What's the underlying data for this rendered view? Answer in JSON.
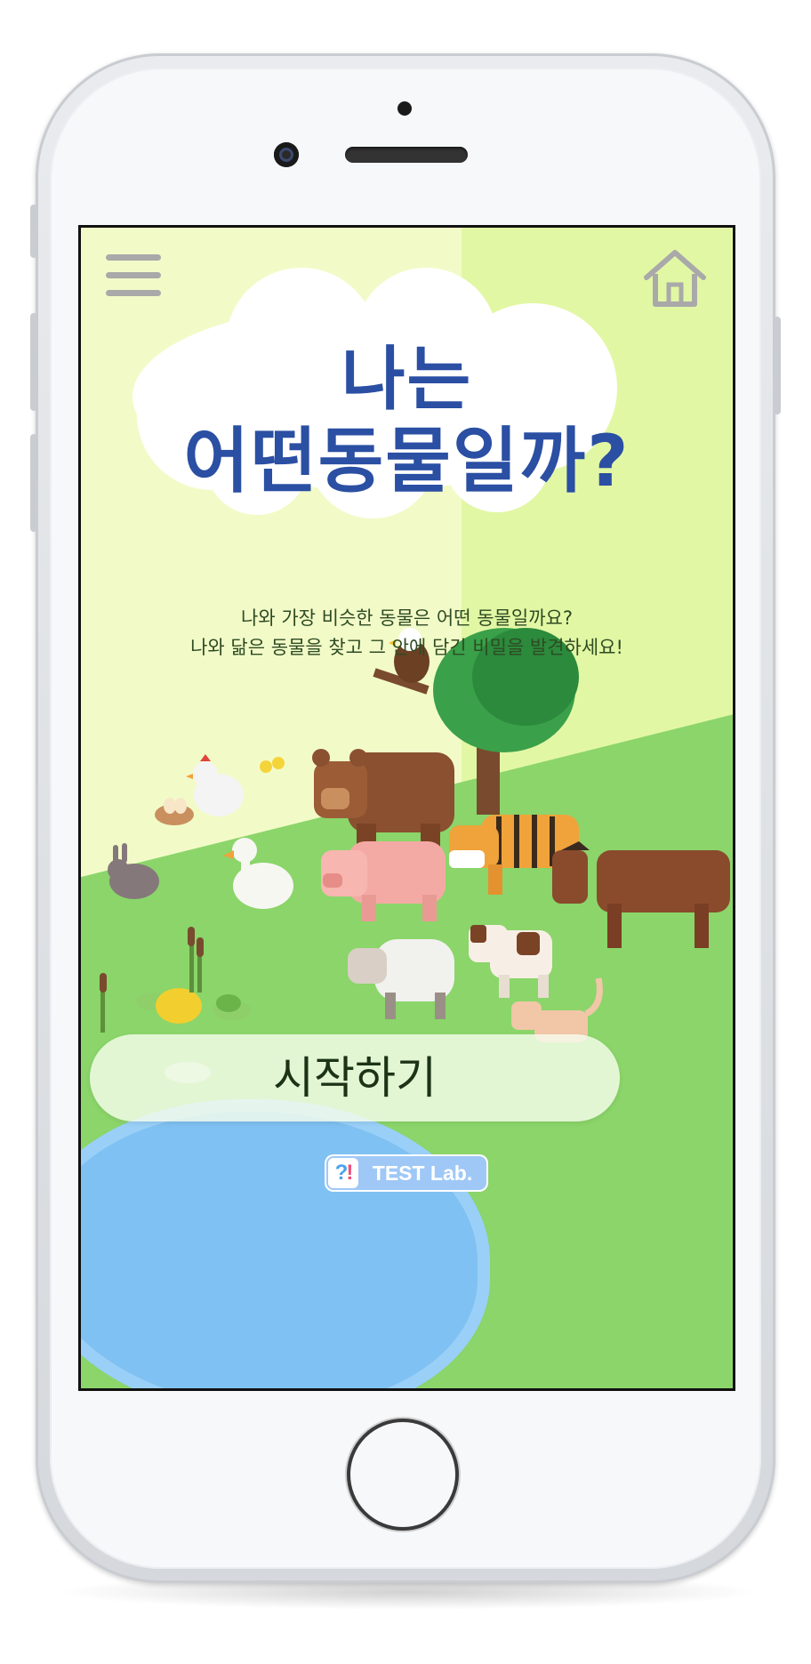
{
  "app": {
    "title_line1": "나는",
    "title_line2": "어떤동물일까?",
    "subtitle_line1": "나와 가장 비슷한 동물은 어떤 동물일까요?",
    "subtitle_line2": "나와 닮은 동물을 찾고 그 안에 담긴 비밀을 발견하세요!",
    "start_button": "시작하기",
    "logo_mark_q": "?",
    "logo_mark_e": "!",
    "logo_text": "TEST Lab."
  },
  "icons": {
    "menu": "hamburger-menu-icon",
    "home": "home-icon"
  },
  "colors": {
    "title": "#2a4fa3",
    "bg_left": "#f2fbc8",
    "bg_right": "#e2f7a4",
    "grass": "#8bd56a",
    "pond": "#7fc1f2",
    "logo_bg": "#9fc8f7"
  }
}
